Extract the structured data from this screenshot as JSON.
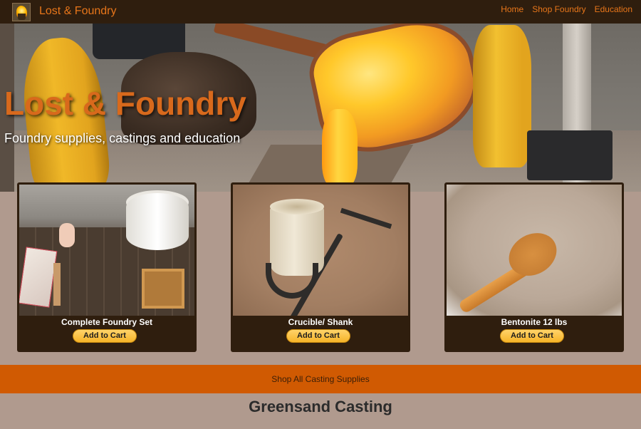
{
  "nav": {
    "brand": "Lost & Foundry",
    "links": [
      "Home",
      "Shop Foundry",
      "Education"
    ]
  },
  "hero": {
    "title": "Lost & Foundry",
    "subtitle": "Foundry supplies, castings and education"
  },
  "products": [
    {
      "name": "Complete Foundry Set",
      "button": "Add to Cart"
    },
    {
      "name": "Crucible/ Shank",
      "button": "Add to Cart"
    },
    {
      "name": "Bentonite 12 lbs",
      "button": "Add to Cart"
    }
  ],
  "shop_all": "Shop All Casting Supplies",
  "section_heading": "Greensand Casting",
  "colors": {
    "nav_bg": "#2f1e0e",
    "accent": "#e8761a",
    "page_bg": "#b09a8e",
    "shop_bar": "#d05a02"
  }
}
